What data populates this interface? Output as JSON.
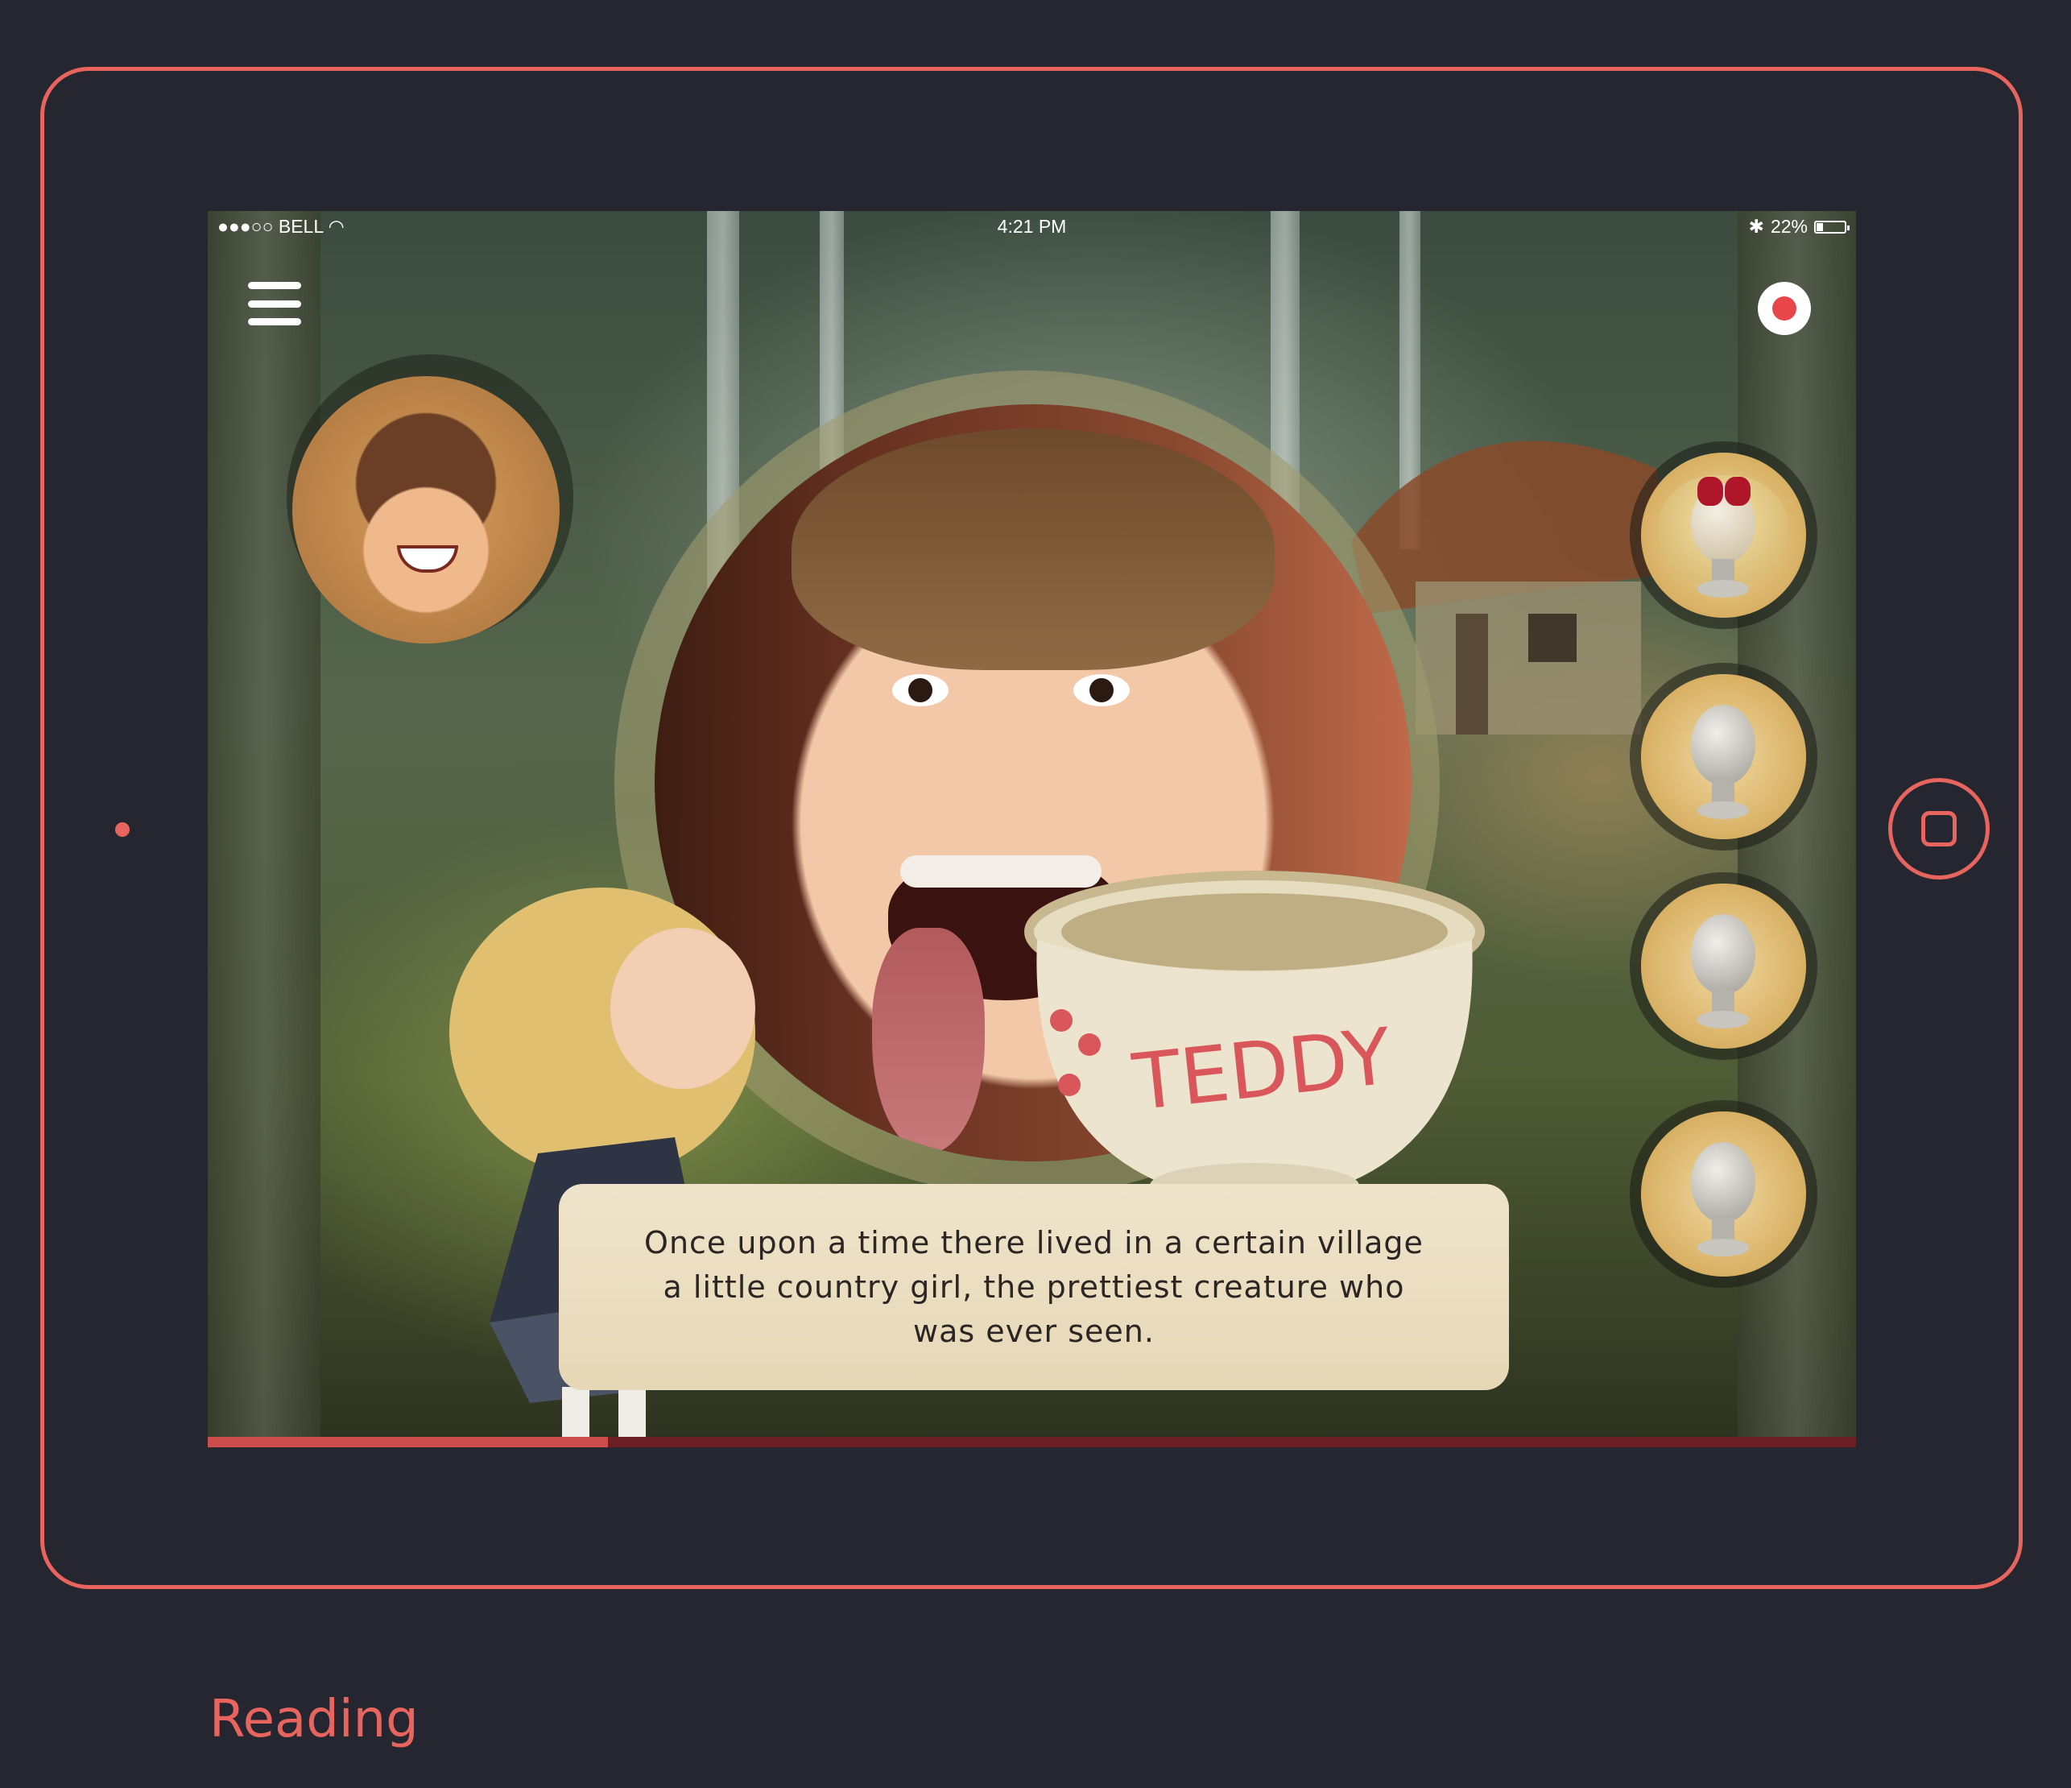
{
  "status_bar": {
    "carrier": "●●●○○ BELL",
    "time": "4:21 PM",
    "battery_percent": "22%",
    "battery_level": 0.22
  },
  "story": {
    "caption": "Once upon a time there lived in a certain village a little country girl, the prettiest creature who was ever seen.",
    "pot_label": "TEDDY"
  },
  "progress": {
    "fraction": 0.243
  },
  "side_items": [
    {
      "type": "wig",
      "icon": "blonde-wig-icon"
    },
    {
      "type": "empty",
      "icon": "mannequin-head-icon"
    },
    {
      "type": "empty",
      "icon": "mannequin-head-icon"
    },
    {
      "type": "empty",
      "icon": "mannequin-head-icon"
    }
  ],
  "screen_label": "Reading",
  "colors": {
    "accent": "#e8645e",
    "background": "#262631",
    "record": "#e8464a",
    "progress_fill": "#cd4c4c",
    "progress_track": "#6b1f24"
  }
}
